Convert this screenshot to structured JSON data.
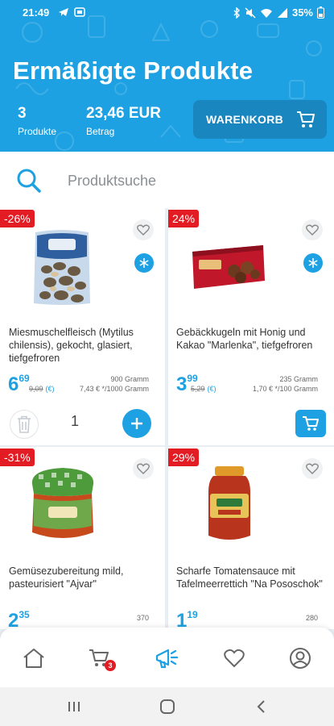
{
  "status_bar": {
    "time": "21:49",
    "battery": "35%"
  },
  "header": {
    "title": "Ermäßigte Produkte",
    "count_value": "3",
    "count_label": "Produkte",
    "amount_value": "23,46 EUR",
    "amount_label": "Betrag",
    "cart_button": "WARENKORB"
  },
  "search": {
    "placeholder": "Produktsuche"
  },
  "products": [
    {
      "discount": "-26%",
      "name": "Miesmuschelfleisch (Mytilus chilensis), gekocht, glasiert, tiefgefroren",
      "price_main": "6",
      "price_cents": "69",
      "old_price": "9,09",
      "currency_note": "(€)",
      "weight": "900 Gramm",
      "unit_price": "7,43 € */1000 Gramm",
      "quantity": "1",
      "frozen": true
    },
    {
      "discount": "24%",
      "name": "Gebäckkugeln mit Honig und Kakao \"Marlenka\", tiefgefroren",
      "price_main": "3",
      "price_cents": "99",
      "old_price": "5,29",
      "currency_note": "(€)",
      "weight": "235 Gramm",
      "unit_price": "1,70 € */100 Gramm",
      "frozen": true
    },
    {
      "discount": "-31%",
      "name": "Gemüsezubereitung mild, pasteurisiert \"Ajvar\"",
      "price_main": "2",
      "price_cents": "35",
      "weight": "370"
    },
    {
      "discount": "29%",
      "name": "Scharfe Tomatensauce mit Tafelmeerrettich \"Na Pososchok\"",
      "price_main": "1",
      "price_cents": "19",
      "weight": "280"
    }
  ],
  "bottom_nav": {
    "cart_badge": "3"
  },
  "colors": {
    "brand": "#1da1e2",
    "sale": "#e31b23"
  }
}
